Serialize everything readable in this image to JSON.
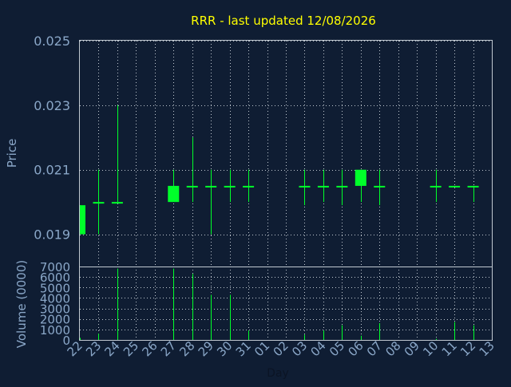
{
  "colors": {
    "background": "#0f1d33",
    "title": "#ffff00",
    "axis_text": "#8aa7c8",
    "grid": "#c0c8d0",
    "frame": "#c0c8d0",
    "candle": "#00ff2a",
    "volume": "#00ff2a"
  },
  "chart_data": [
    {
      "type": "candlestick",
      "title": "RRR - last updated 12/08/2026",
      "xlabel": "",
      "ylabel": "Price",
      "ylim": [
        0.018,
        0.025
      ],
      "yticks": [
        "0.019",
        "0.021",
        "0.023",
        "0.025"
      ],
      "ytick_values": [
        0.019,
        0.021,
        0.023,
        0.025
      ],
      "grid": true,
      "x_tick_labels": [
        "22",
        "23",
        "24",
        "25",
        "26",
        "27",
        "28",
        "29",
        "30",
        "31",
        "01",
        "02",
        "03",
        "04",
        "05",
        "06",
        "07",
        "08",
        "09",
        "10",
        "11",
        "12",
        "13"
      ],
      "candles": [
        {
          "day": "22",
          "open": 0.0199,
          "high": 0.0199,
          "low": 0.019,
          "close": 0.019
        },
        {
          "day": "23",
          "open": 0.02,
          "high": 0.021,
          "low": 0.019,
          "close": 0.02
        },
        {
          "day": "24",
          "open": 0.02,
          "high": 0.023,
          "low": 0.02,
          "close": 0.02
        },
        {
          "day": "27",
          "open": 0.02,
          "high": 0.021,
          "low": 0.02,
          "close": 0.0205
        },
        {
          "day": "28",
          "open": 0.0205,
          "high": 0.022,
          "low": 0.02,
          "close": 0.0205
        },
        {
          "day": "29",
          "open": 0.0205,
          "high": 0.021,
          "low": 0.019,
          "close": 0.0205
        },
        {
          "day": "30",
          "open": 0.0205,
          "high": 0.021,
          "low": 0.02,
          "close": 0.0205
        },
        {
          "day": "31",
          "open": 0.0205,
          "high": 0.021,
          "low": 0.02,
          "close": 0.0205
        },
        {
          "day": "03",
          "open": 0.0205,
          "high": 0.021,
          "low": 0.0199,
          "close": 0.0205
        },
        {
          "day": "04",
          "open": 0.0205,
          "high": 0.021,
          "low": 0.02,
          "close": 0.0205
        },
        {
          "day": "05",
          "open": 0.0205,
          "high": 0.021,
          "low": 0.0199,
          "close": 0.0205
        },
        {
          "day": "06",
          "open": 0.0205,
          "high": 0.021,
          "low": 0.02,
          "close": 0.021
        },
        {
          "day": "07",
          "open": 0.0205,
          "high": 0.021,
          "low": 0.0199,
          "close": 0.0205
        },
        {
          "day": "10",
          "open": 0.0205,
          "high": 0.021,
          "low": 0.02,
          "close": 0.0205
        },
        {
          "day": "11",
          "open": 0.0205,
          "high": 0.0205,
          "low": 0.0205,
          "close": 0.0205
        },
        {
          "day": "12",
          "open": 0.0205,
          "high": 0.0205,
          "low": 0.02,
          "close": 0.0205
        }
      ]
    },
    {
      "type": "bar",
      "title": "",
      "xlabel": "Day",
      "ylabel": "Volume (0000)",
      "ylim": [
        0,
        7000
      ],
      "yticks": [
        "0",
        "1000",
        "2000",
        "3000",
        "4000",
        "5000",
        "6000",
        "7000"
      ],
      "ytick_values": [
        0,
        1000,
        2000,
        3000,
        4000,
        5000,
        6000,
        7000
      ],
      "grid": true,
      "x_tick_labels": [
        "22",
        "23",
        "24",
        "25",
        "26",
        "27",
        "28",
        "29",
        "30",
        "31",
        "01",
        "02",
        "03",
        "04",
        "05",
        "06",
        "07",
        "08",
        "09",
        "10",
        "11",
        "12",
        "13"
      ],
      "categories": [
        "22",
        "23",
        "24",
        "27",
        "28",
        "29",
        "30",
        "31",
        "03",
        "04",
        "05",
        "06",
        "07",
        "10",
        "11",
        "12"
      ],
      "values": [
        200,
        600,
        6800,
        6800,
        6300,
        4300,
        4300,
        900,
        500,
        900,
        1400,
        400,
        1600,
        100,
        1700,
        1400
      ]
    }
  ]
}
